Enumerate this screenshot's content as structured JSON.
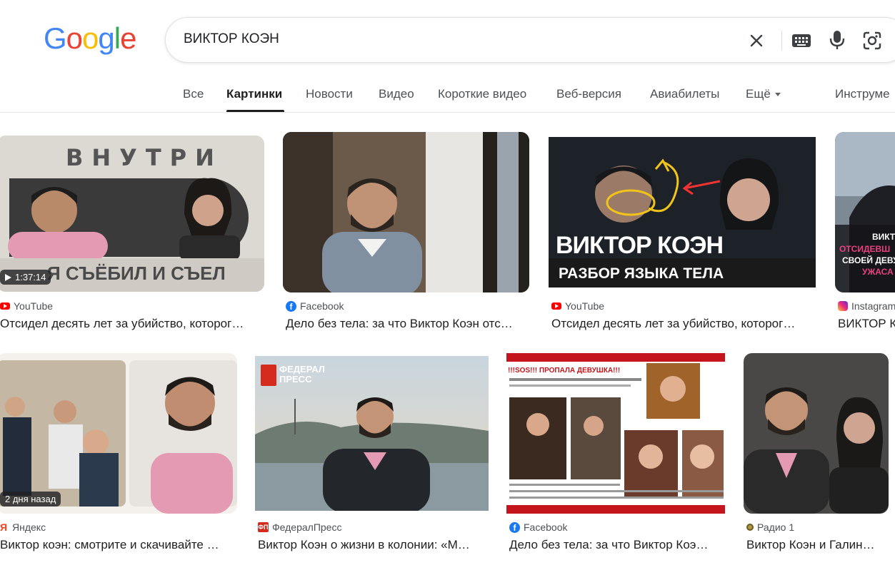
{
  "header": {
    "logo_letters": [
      {
        "ch": "G",
        "color": "#4285F4"
      },
      {
        "ch": "o",
        "color": "#EA4335"
      },
      {
        "ch": "o",
        "color": "#FBBC05"
      },
      {
        "ch": "g",
        "color": "#4285F4"
      },
      {
        "ch": "l",
        "color": "#34A853"
      },
      {
        "ch": "e",
        "color": "#EA4335"
      }
    ],
    "search_query": "ВИКТОР КОЭН"
  },
  "tabs": [
    {
      "label": "Все"
    },
    {
      "label": "Картинки",
      "active": true
    },
    {
      "label": "Новости"
    },
    {
      "label": "Видео"
    },
    {
      "label": "Короткие видео"
    },
    {
      "label": "Веб-версия"
    },
    {
      "label": "Авиабилеты"
    },
    {
      "label": "Ещё"
    },
    {
      "label": "Инструме"
    }
  ],
  "results": [
    {
      "source": "YouTube",
      "source_icon": "youtube-icon",
      "title": "Отсидел десять лет за убийство, которог…",
      "badge": "1:37:14",
      "overlay": "Я СЪЁБИЛ И СЪЕЛ"
    },
    {
      "source": "Facebook",
      "source_icon": "facebook-icon",
      "title": "Дело без тела: за что Виктор Коэн отс…"
    },
    {
      "source": "YouTube",
      "source_icon": "youtube-icon",
      "title": "Отсидел десять лет за убийство, которог…",
      "overlay": "ВИКТОР КОЭН",
      "overlay2": "РАЗБОР ЯЗЫКА ТЕЛА"
    },
    {
      "source": "Instagram",
      "source_icon": "instagram-icon",
      "title": "ВИКТОР К"
    },
    {
      "source": "Яндекс",
      "source_icon": "yandex-icon",
      "title": "Виктор коэн: смотрите и скачивайте …",
      "badge": "2 дня назад"
    },
    {
      "source": "ФедералПресс",
      "source_icon": "federalpress-icon",
      "title": "Виктор Коэн о жизни в колонии: «М…",
      "overlay": "ФЕДЕРАЛ ПРЕСС"
    },
    {
      "source": "Facebook",
      "source_icon": "facebook-icon",
      "title": "Дело без тела: за что Виктор Коэ…",
      "overlay": "!!!SOS!!! ПРОПАЛА ДЕВУШКА!!!"
    },
    {
      "source": "Радио 1",
      "source_icon": "radio-icon",
      "title": "Виктор Коэн и Галин…"
    }
  ]
}
